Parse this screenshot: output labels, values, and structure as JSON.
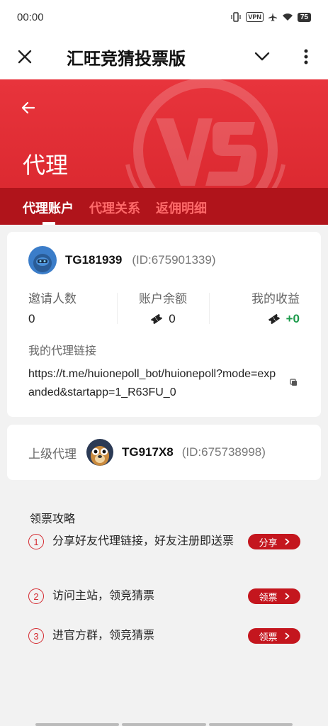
{
  "status_bar": {
    "time": "00:00",
    "vpn": "VPN",
    "battery": "75"
  },
  "app_bar": {
    "title": "汇旺竞猜投票版"
  },
  "header": {
    "title": "代理"
  },
  "tabs": [
    {
      "label": "代理账户",
      "active": true
    },
    {
      "label": "代理关系",
      "active": false
    },
    {
      "label": "返佣明细",
      "active": false
    }
  ],
  "account": {
    "username": "TG181939",
    "user_id": "(ID:675901339)",
    "stats": {
      "invites_label": "邀请人数",
      "invites_value": "0",
      "balance_label": "账户余额",
      "balance_value": "0",
      "earnings_label": "我的收益",
      "earnings_value": "+0"
    },
    "link_label": "我的代理链接",
    "link": "https://t.me/huionepoll_bot/huionepoll?mode=expanded&startapp=1_R63FU_0"
  },
  "upline": {
    "label": "上级代理",
    "username": "TG917X8",
    "user_id": "(ID:675738998)"
  },
  "guide": {
    "title": "领票攻略",
    "items": [
      {
        "num": "1",
        "text": "分享好友代理链接，好友注册即送票",
        "button": "分享"
      },
      {
        "num": "2",
        "text": "访问主站，领竞猜票",
        "button": "领票"
      },
      {
        "num": "3",
        "text": "进官方群，领竞猜票",
        "button": "领票"
      }
    ]
  },
  "colors": {
    "accent": "#d8262d",
    "tab_bar": "#b0141b",
    "positive": "#1b9a4a"
  }
}
